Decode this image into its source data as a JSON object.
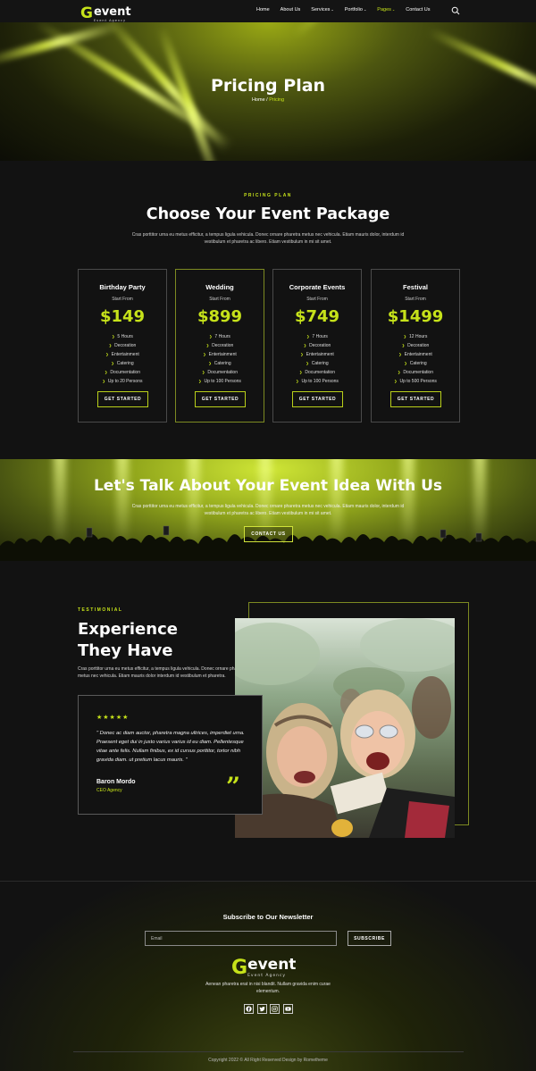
{
  "nav": {
    "logo": {
      "mark": "G",
      "word": "event",
      "tagline": "Event Agency"
    },
    "items": [
      {
        "label": "Home",
        "has_dropdown": false,
        "active": false
      },
      {
        "label": "About Us",
        "has_dropdown": false,
        "active": false
      },
      {
        "label": "Services",
        "has_dropdown": true,
        "active": false
      },
      {
        "label": "Portfolio",
        "has_dropdown": true,
        "active": false
      },
      {
        "label": "Pages",
        "has_dropdown": true,
        "active": true
      },
      {
        "label": "Contact Us",
        "has_dropdown": false,
        "active": false
      }
    ],
    "search_icon": "search-icon"
  },
  "hero": {
    "title": "Pricing Plan",
    "breadcrumb": {
      "home": "Home",
      "separator": " / ",
      "current": "Pricing"
    }
  },
  "pricing": {
    "eyebrow": "PRICING PLAN",
    "title": "Choose Your Event Package",
    "description": "Cras porttitor urna eu metus efficitur, a tempus ligula vehicula. Donec ornare pharetra metus nec vehicula. Etiam mauris dolor, interdum id vestibulum et pharetra ac libero. Etiam vestibulum in mi sit amet.",
    "plans": [
      {
        "name": "Birthday Party",
        "start_label": "Start From",
        "price": "$149",
        "features": [
          "5 Hours",
          "Decoration",
          "Entertainment",
          "Catering",
          "Documentation",
          "Up to 20 Persons"
        ],
        "button": "GET STARTED",
        "featured": false
      },
      {
        "name": "Wedding",
        "start_label": "Start From",
        "price": "$899",
        "features": [
          "7 Hours",
          "Decoration",
          "Entertainment",
          "Catering",
          "Documentation",
          "Up to 100 Persons"
        ],
        "button": "GET STARTED",
        "featured": true
      },
      {
        "name": "Corporate Events",
        "start_label": "Start From",
        "price": "$749",
        "features": [
          "7 Hours",
          "Decoration",
          "Entertainment",
          "Catering",
          "Documentation",
          "Up to 100 Persons"
        ],
        "button": "GET STARTED",
        "featured": false
      },
      {
        "name": "Festival",
        "start_label": "Start From",
        "price": "$1499",
        "features": [
          "12 Hours",
          "Decoration",
          "Entertainment",
          "Catering",
          "Documentation",
          "Up to 500 Persons"
        ],
        "button": "GET STARTED",
        "featured": false
      }
    ]
  },
  "cta": {
    "title": "Let's Talk About Your Event Idea With Us",
    "description": "Cras porttitor urna eu metus efficitur, a tempus ligula vehicula. Donec ornare pharetra metus nec vehicula. Etiam mauris dolor, interdum id vestibulum et pharetra ac libero. Etiam vestibulum in mi sit amet.",
    "button": "CONTACT US"
  },
  "testimonial": {
    "eyebrow": "TESTIMONIAL",
    "title_line1": "Experience",
    "title_line2": "They Have",
    "description": "Cras porttitor urna eu metus efficitur, a tempus ligula vehicula. Donec ornare pharetra metus nec vehicula. Etiam mauris dolor interdum id vestibulum et pharetra.",
    "stars": "★★★★★",
    "rating": 5,
    "quote": "\" Donec ac diam auctor, pharetra magna ultrices, imperdiet urna. Praesent eget dui in justo varius varius id eu diam. Pellentesque vitae ante felis. Nullam finibus, ex id cursus porttitor, tortor nibh gravida diam. ut pretium lacus mauris. \"",
    "author": "Baron Mordo",
    "role": "CEO Agency",
    "quote_mark": "”"
  },
  "footer": {
    "newsletter_title": "Subscribe to Our Newsletter",
    "email_placeholder": "Email",
    "subscribe_button": "SUBSCRIBE",
    "logo": {
      "mark": "G",
      "word": "event",
      "tagline": "Event Agency"
    },
    "description": "Aenean pharetra erat in nisi blandit. Nullam gravida enim curae elementum.",
    "socials": [
      "facebook-icon",
      "twitter-icon",
      "instagram-icon",
      "youtube-icon"
    ],
    "copyright": "Copyright 2022 © All Right Reserved Design by Rometheme"
  },
  "colors": {
    "accent": "#c6e21a",
    "background": "#121212",
    "text": "#ffffff"
  }
}
